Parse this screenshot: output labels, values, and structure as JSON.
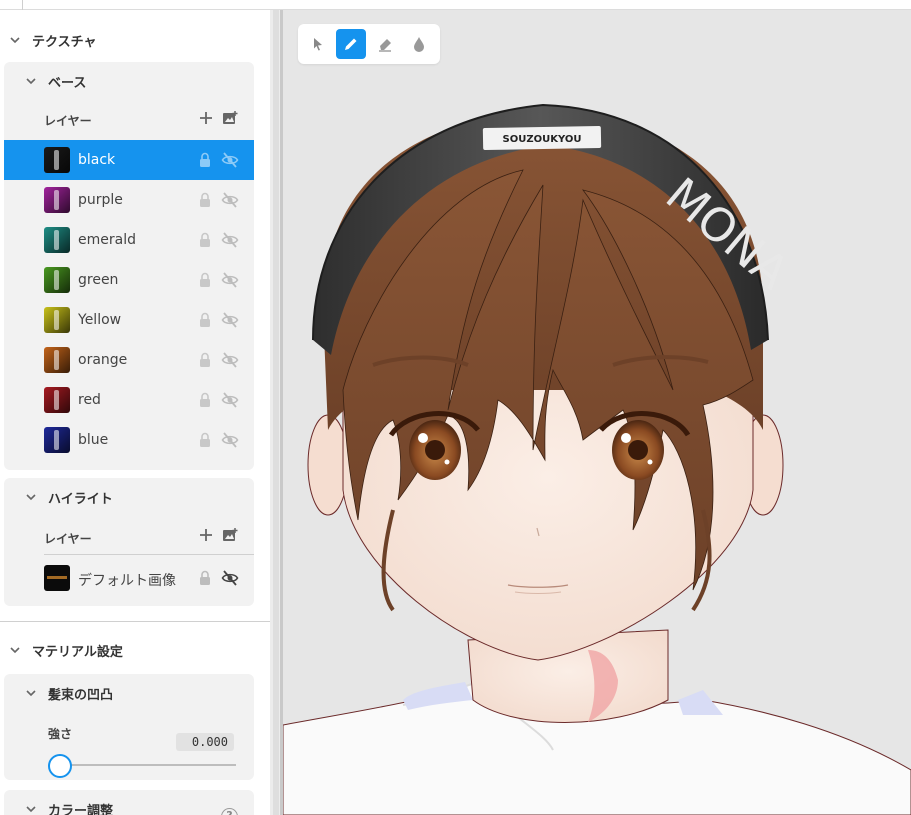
{
  "sidebar": {
    "texture_section": {
      "title": "テクスチャ"
    },
    "base_card": {
      "title": "ベース",
      "layers_label": "レイヤー",
      "layers": [
        {
          "name": "black",
          "color": "#1a1a1a",
          "selected": true
        },
        {
          "name": "purple",
          "color": "#a3249e",
          "selected": false
        },
        {
          "name": "emerald",
          "color": "#1f8f87",
          "selected": false
        },
        {
          "name": "green",
          "color": "#4a9a21",
          "selected": false
        },
        {
          "name": "Yellow",
          "color": "#c9c21a",
          "selected": false
        },
        {
          "name": "orange",
          "color": "#c4641a",
          "selected": false
        },
        {
          "name": "red",
          "color": "#a81b22",
          "selected": false
        },
        {
          "name": "blue",
          "color": "#1f2a9c",
          "selected": false
        }
      ]
    },
    "highlight_card": {
      "title": "ハイライト",
      "layers_label": "レイヤー",
      "layers": [
        {
          "name": "デフォルト画像",
          "color": "#0b0b0b"
        }
      ]
    },
    "material_section": {
      "title": "マテリアル設定"
    },
    "bump_card": {
      "title": "髪束の凹凸",
      "strength_label": "強さ",
      "strength_value": "0.000",
      "strength_fraction": 0
    },
    "color_card": {
      "title": "カラー調整",
      "help": "?"
    }
  },
  "toolbar": {
    "tools": [
      {
        "icon": "select-arrow-icon",
        "active": false
      },
      {
        "icon": "pen-icon",
        "active": true
      },
      {
        "icon": "eraser-icon",
        "active": false
      },
      {
        "icon": "fill-drop-icon",
        "active": false
      }
    ]
  },
  "viewport": {
    "headband_label": "SOUZOUKYOU",
    "headband_text": "MONA",
    "accent": "#1593ee",
    "skin": "#f8e6dc",
    "hair": "#7a4a2e",
    "eye": "#8a4a22"
  }
}
